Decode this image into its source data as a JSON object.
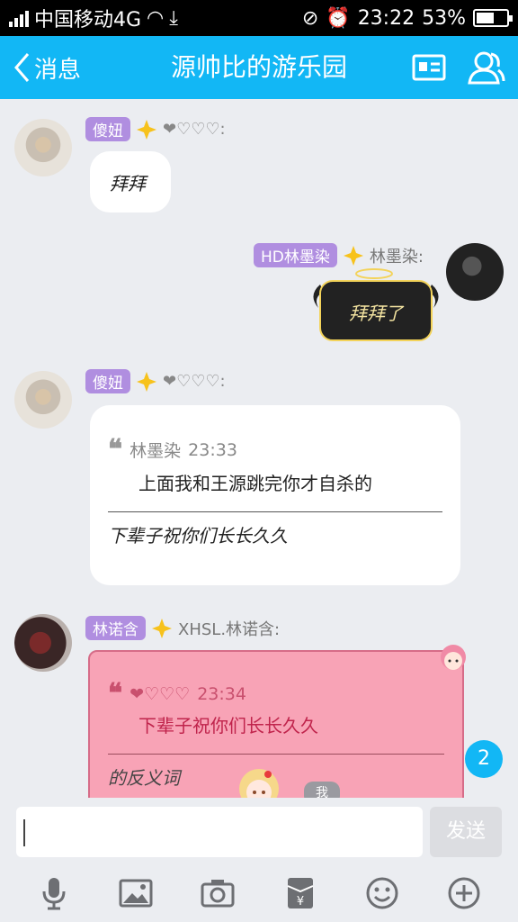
{
  "status": {
    "carrier": "中国移动4G",
    "time": "23:22",
    "battery": "53%"
  },
  "nav": {
    "back_label": "消息",
    "title": "源帅比的游乐园"
  },
  "messages": [
    {
      "tag": "傻妞",
      "hearts": "❤♡♡♡:",
      "text": "拜拜"
    },
    {
      "tag": "HD林墨染",
      "name": "林墨染:",
      "text": "拜拜了"
    },
    {
      "tag": "傻妞",
      "hearts": "❤♡♡♡:",
      "quote_author": "林墨染",
      "quote_time": "23:33",
      "quote_text": "上面我和王源跳完你才自杀的",
      "text": "下辈子祝你们长长久久"
    },
    {
      "tag": "林诺含",
      "name": "XHSL.林诺含:",
      "quote_author": "❤♡♡♡",
      "quote_time": "23:34",
      "quote_text": "下辈子祝你们长长久久",
      "text": "的反义词"
    }
  ],
  "unread_count": "2",
  "me_label": "我",
  "input": {
    "placeholder": ""
  },
  "send_label": "发送",
  "toolbar": [
    "microphone-icon",
    "image-icon",
    "camera-icon",
    "red-packet-icon",
    "emoji-icon",
    "plus-icon"
  ],
  "colors": {
    "accent": "#12b7f5",
    "tag": "#b08ee0",
    "pink_bubble": "#f8a3b6"
  }
}
